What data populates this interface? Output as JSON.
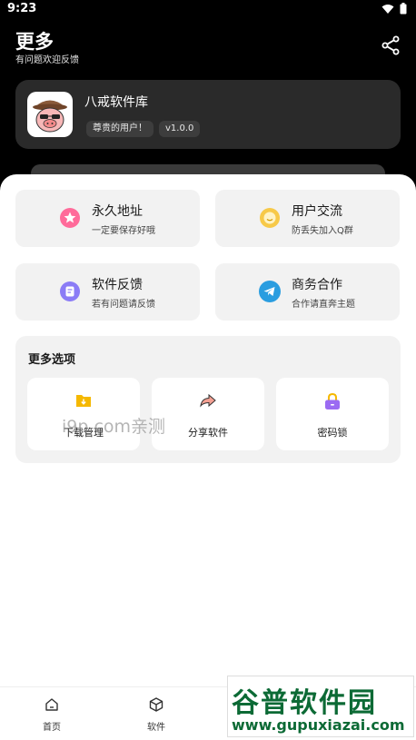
{
  "status_bar": {
    "time": "9:23"
  },
  "header": {
    "title": "更多",
    "subtitle": "有问题欢迎反馈"
  },
  "profile": {
    "app_name": "八戒软件库",
    "user_badge": "尊贵的用户！",
    "version_badge": "v1.0.0"
  },
  "tiles": [
    {
      "title": "永久地址",
      "subtitle": "一定要保存好哦",
      "icon": "star-icon",
      "color": "#ff6b9a"
    },
    {
      "title": "用户交流",
      "subtitle": "防丢失加入Q群",
      "icon": "smile-icon",
      "color": "#f7c948"
    },
    {
      "title": "软件反馈",
      "subtitle": "若有问题请反馈",
      "icon": "feedback-icon",
      "color": "#8b7cf6"
    },
    {
      "title": "商务合作",
      "subtitle": "合作请直奔主题",
      "icon": "telegram-icon",
      "color": "#2a9de0"
    }
  ],
  "more_options": {
    "title": "更多选项",
    "items": [
      {
        "label": "下载管理",
        "icon": "download-folder-icon",
        "color": "#f5b800"
      },
      {
        "label": "分享软件",
        "icon": "share-arrow-icon",
        "color": "#f08c7a"
      },
      {
        "label": "密码锁",
        "icon": "lock-icon",
        "color": "#9b6bf2"
      }
    ]
  },
  "watermark": "i9p.com亲测",
  "bottom_nav": [
    {
      "label": "首页",
      "icon": "home-icon"
    },
    {
      "label": "软件",
      "icon": "box-icon"
    }
  ],
  "site_logo": {
    "name": "谷普软件园",
    "url": "www.gupuxiazai.com"
  }
}
